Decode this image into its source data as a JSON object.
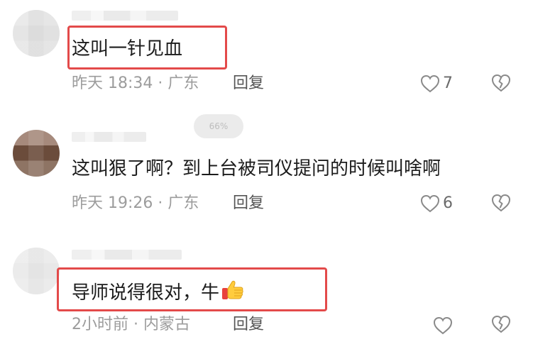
{
  "zoom_indicator": "66%",
  "colors": {
    "highlight_border": "#e34a4a",
    "meta_text": "#9c9c9c",
    "reply_text": "#555555",
    "icon_stroke": "#8a8a8a"
  },
  "comments": [
    {
      "username": "",
      "text": "这叫一针见血",
      "meta": "昨天 18:34 · 广东",
      "reply_label": "回复",
      "like_count": "7"
    },
    {
      "username": "",
      "text": "这叫狠了啊？到上台被司仪提问的时候叫啥啊",
      "meta": "昨天 19:26 · 广东",
      "reply_label": "回复",
      "like_count": "6"
    },
    {
      "username": "",
      "text": "导师说得很对，牛",
      "meta": "2小时前 · 内蒙古",
      "reply_label": "回复",
      "like_count": ""
    }
  ]
}
